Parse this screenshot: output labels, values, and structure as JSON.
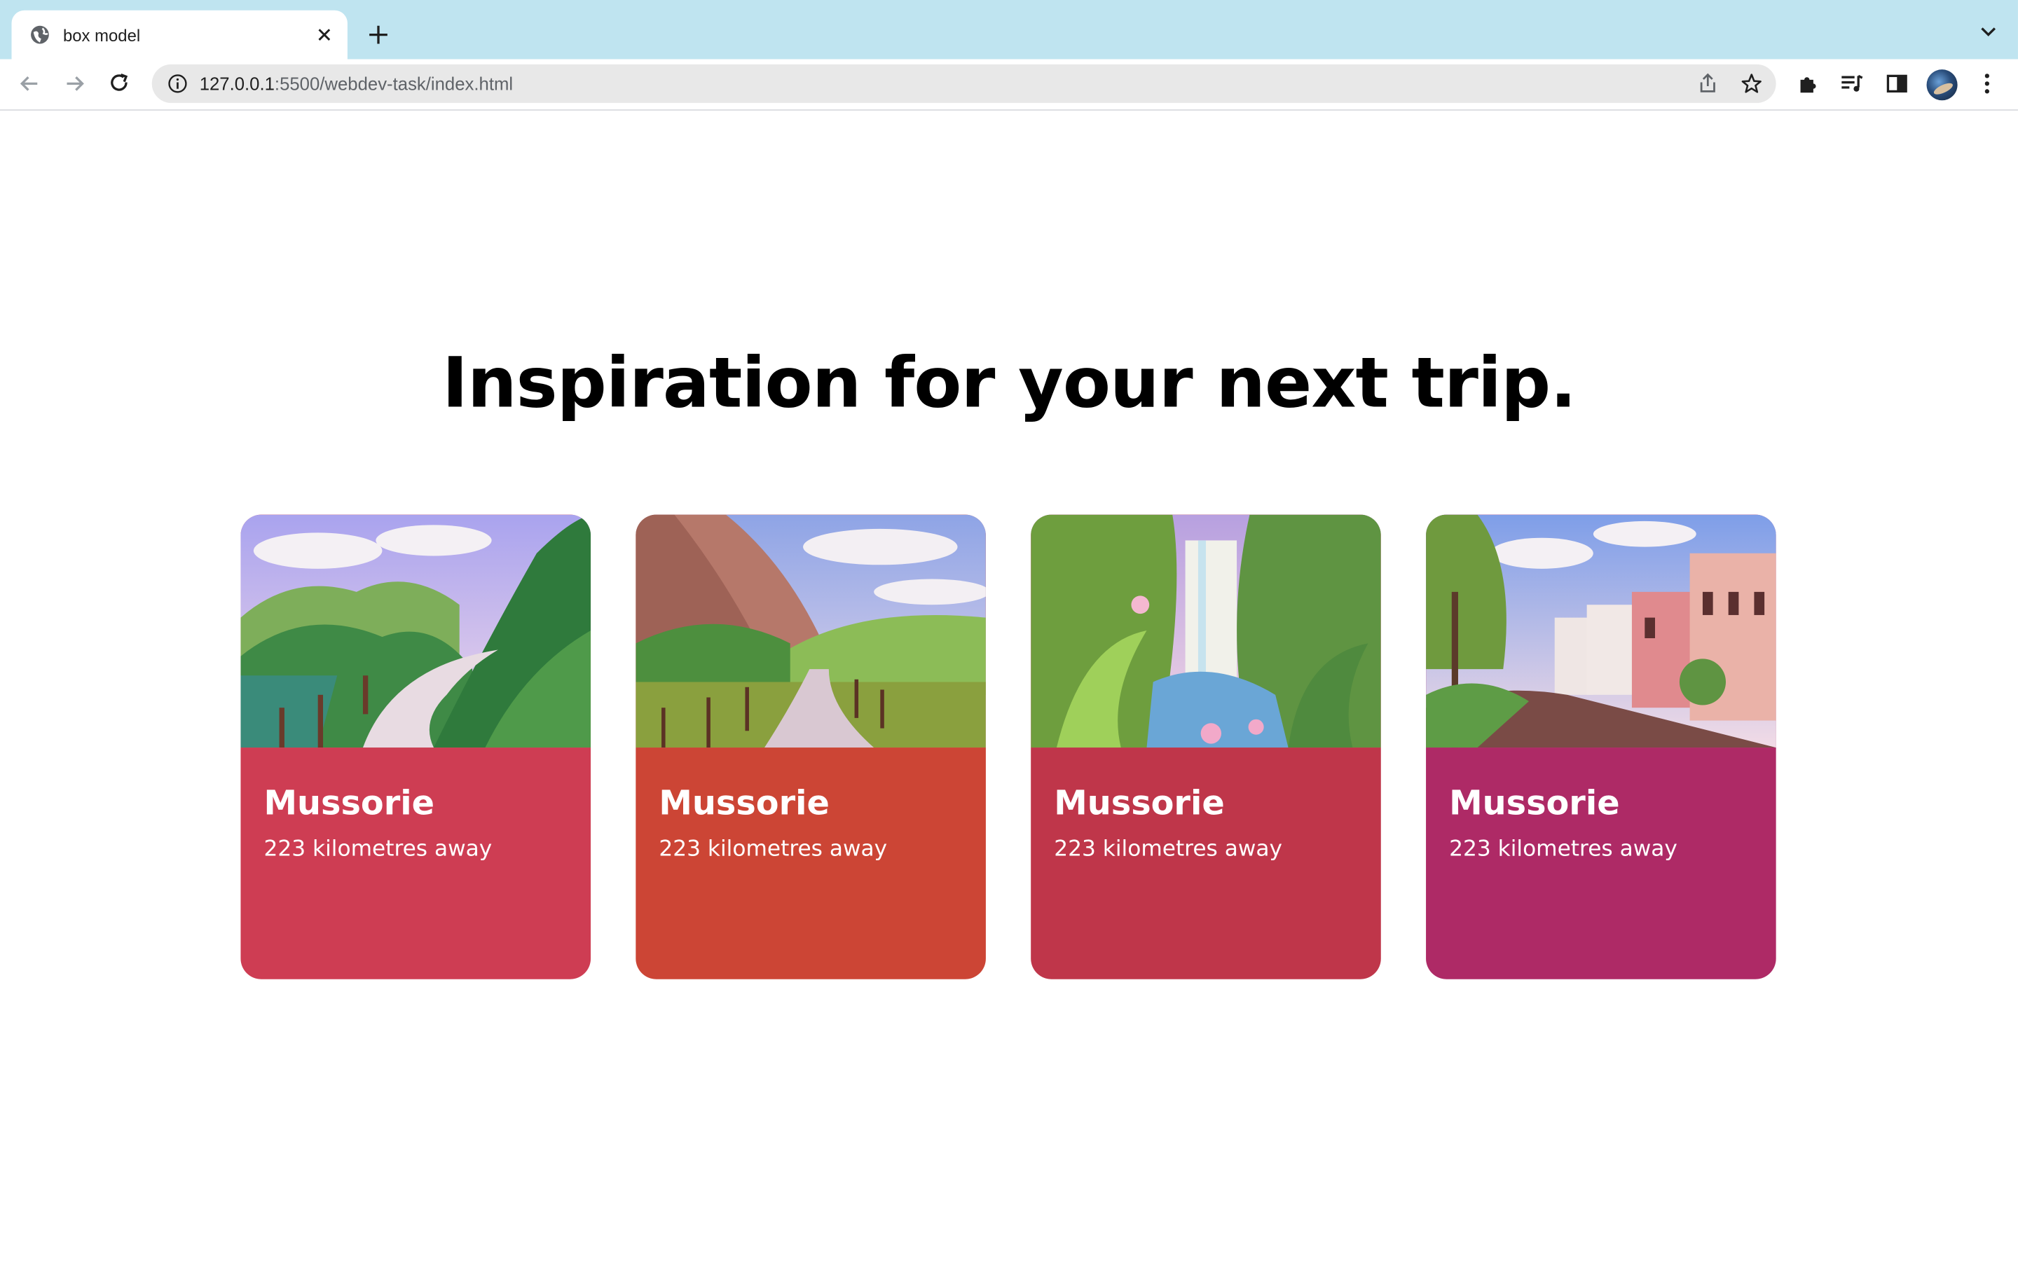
{
  "browser": {
    "tab": {
      "title": "box model"
    },
    "address": {
      "host": "127.0.0.1",
      "path": ":5500/webdev-task/index.html"
    }
  },
  "page": {
    "heading": "Inspiration for your next trip.",
    "cards": [
      {
        "name": "Mussorie",
        "distance": "223 kilometres away",
        "color": "#ce3d53"
      },
      {
        "name": "Mussorie",
        "distance": "223 kilometres away",
        "color": "#cc4535"
      },
      {
        "name": "Mussorie",
        "distance": "223 kilometres away",
        "color": "#bf364a"
      },
      {
        "name": "Mussorie",
        "distance": "223 kilometres away",
        "color": "#ae2a66"
      }
    ]
  },
  "icons": [
    "globe-icon",
    "close-icon",
    "plus-icon",
    "chevron-down-icon",
    "back-arrow-icon",
    "forward-arrow-icon",
    "reload-icon",
    "info-icon",
    "share-icon",
    "star-icon",
    "extensions-icon",
    "media-icon",
    "side-panel-icon",
    "menu-dots-icon"
  ]
}
